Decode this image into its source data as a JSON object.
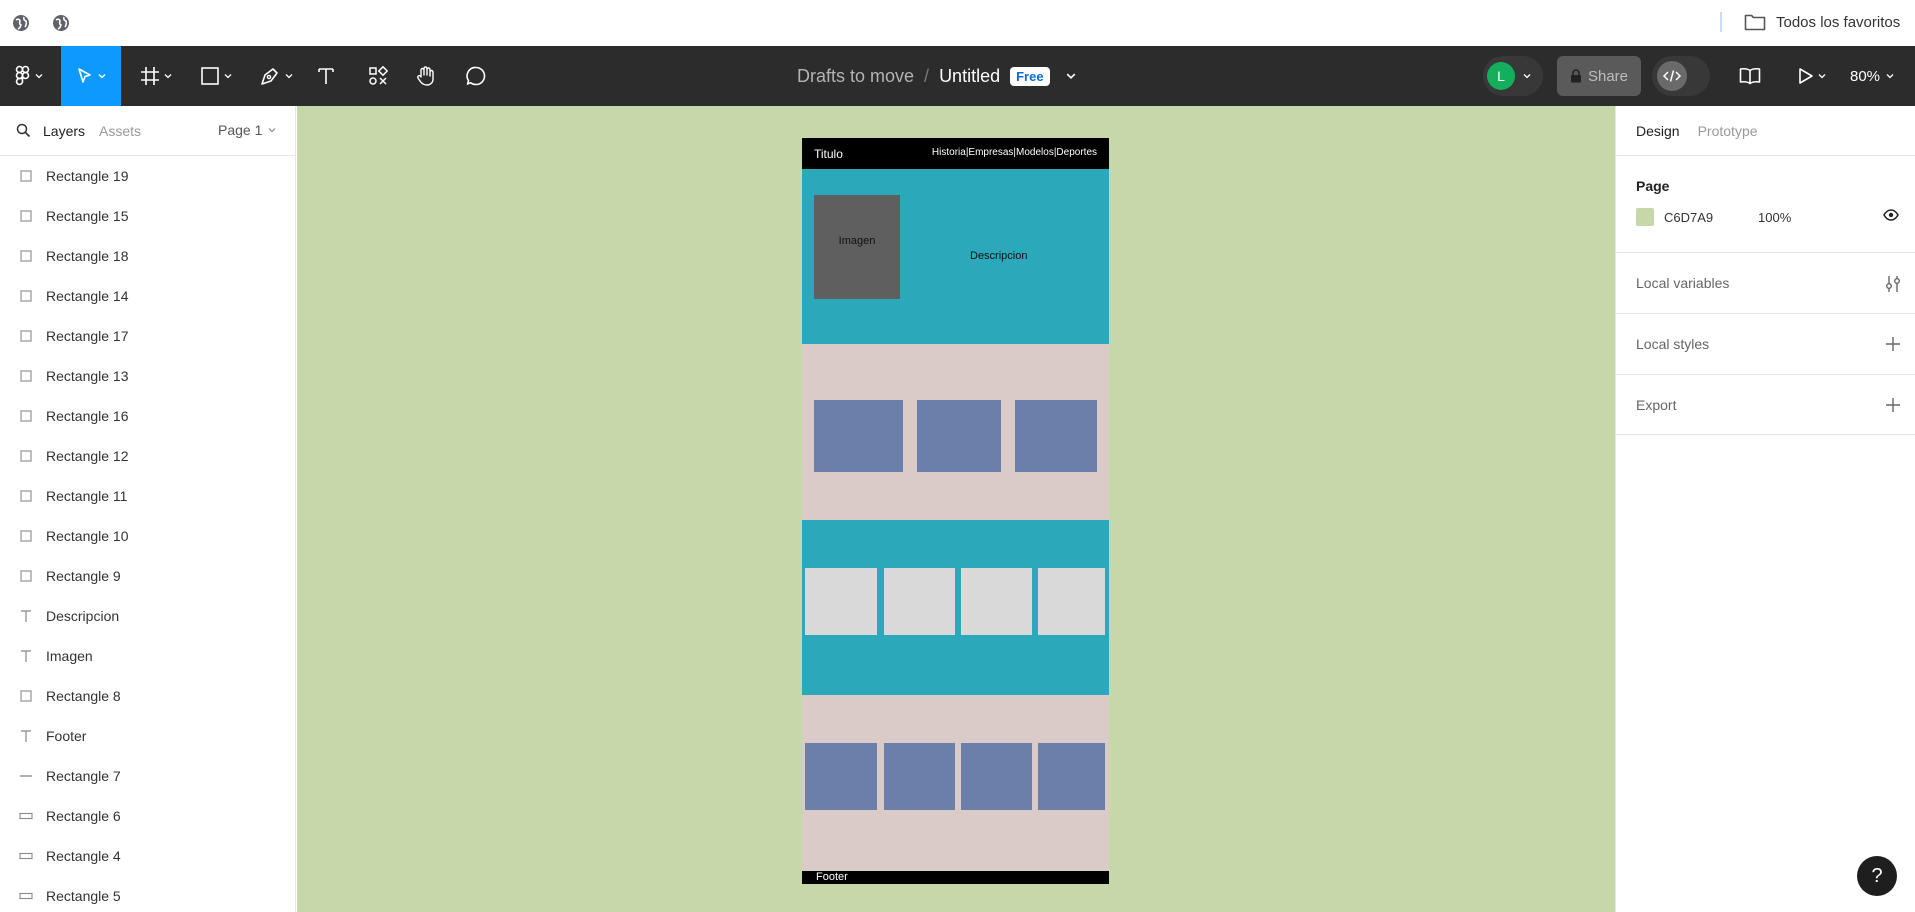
{
  "browser": {
    "bookmarks_folder": "Todos los favoritos"
  },
  "toolbar": {
    "project": "Drafts to move",
    "separator": "/",
    "file_title": "Untitled",
    "plan_badge": "Free",
    "avatar_initial": "L",
    "share_label": "Share",
    "zoom": "80%"
  },
  "left_panel": {
    "tabs": [
      "Layers",
      "Assets"
    ],
    "page_selector": "Page 1",
    "layers": [
      {
        "name": "Rectangle 19",
        "icon": "frame-rect-icon"
      },
      {
        "name": "Rectangle 15",
        "icon": "frame-rect-icon"
      },
      {
        "name": "Rectangle 18",
        "icon": "frame-rect-icon"
      },
      {
        "name": "Rectangle 14",
        "icon": "frame-rect-icon"
      },
      {
        "name": "Rectangle 17",
        "icon": "frame-rect-icon"
      },
      {
        "name": "Rectangle 13",
        "icon": "frame-rect-icon"
      },
      {
        "name": "Rectangle 16",
        "icon": "frame-rect-icon"
      },
      {
        "name": "Rectangle 12",
        "icon": "frame-rect-icon"
      },
      {
        "name": "Rectangle 11",
        "icon": "frame-rect-icon"
      },
      {
        "name": "Rectangle 10",
        "icon": "frame-rect-icon"
      },
      {
        "name": "Rectangle 9",
        "icon": "frame-rect-icon"
      },
      {
        "name": "Descripcion",
        "icon": "text-icon"
      },
      {
        "name": "Imagen",
        "icon": "text-icon"
      },
      {
        "name": "Rectangle 8",
        "icon": "frame-rect-icon"
      },
      {
        "name": "Footer",
        "icon": "text-icon"
      },
      {
        "name": "Rectangle 7",
        "icon": "line-icon"
      },
      {
        "name": "Rectangle 6",
        "icon": "wide-rect-icon"
      },
      {
        "name": "Rectangle 4",
        "icon": "wide-rect-icon"
      },
      {
        "name": "Rectangle 5",
        "icon": "wide-rect-icon"
      }
    ]
  },
  "canvas": {
    "background": "#C6D7A9",
    "frame": {
      "header_title": "Titulo",
      "header_nav": "Historia|Empresas|Modelos|Deportes",
      "hero_image_label": "Imagen",
      "hero_description": "Descripcion",
      "footer_label": "Footer",
      "colors": {
        "header": "#000000",
        "teal": "#2BA8B9",
        "pink": "#DACBC8",
        "grey_box": "#5F5F5F",
        "blue_card": "#6A80AA",
        "light_card": "#D9D9D9"
      }
    }
  },
  "right_panel": {
    "tabs": [
      "Design",
      "Prototype"
    ],
    "page_section_title": "Page",
    "page_color_hex": "C6D7A9",
    "page_color_swatch": "#C6D7A9",
    "page_opacity": "100%",
    "sections": [
      "Local variables",
      "Local styles",
      "Export"
    ]
  },
  "help_label": "?"
}
